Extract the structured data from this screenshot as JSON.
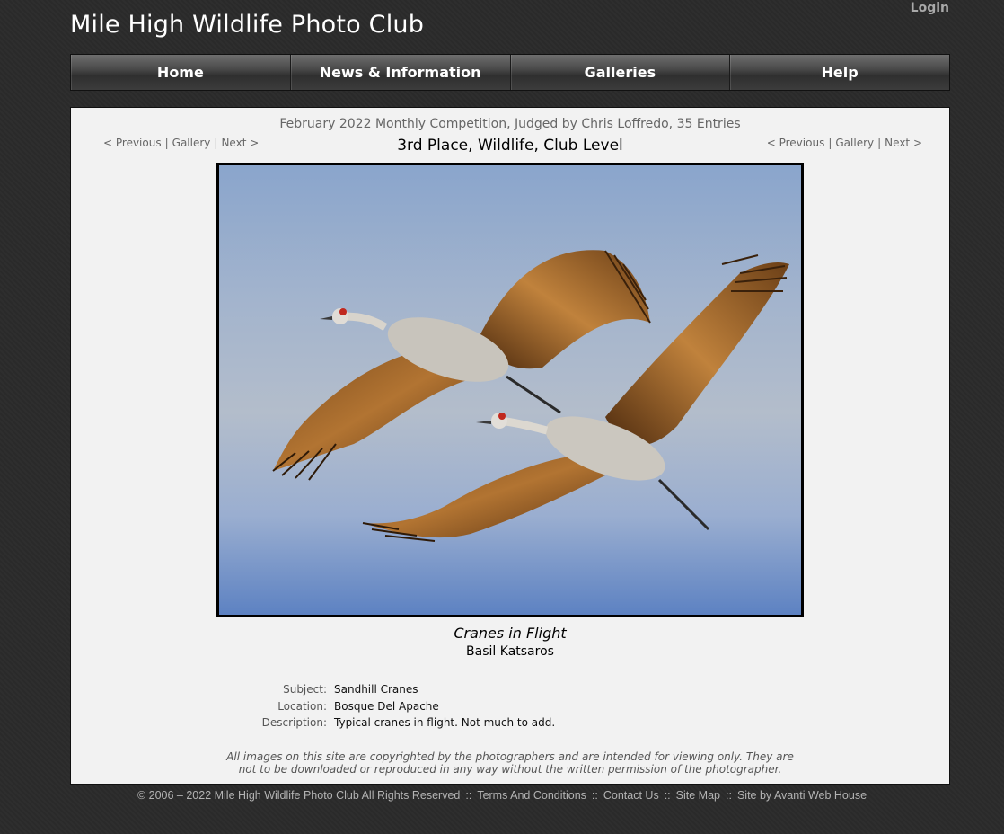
{
  "site": {
    "title": "Mile High Wildlife Photo Club",
    "login_label": "Login"
  },
  "nav": {
    "items": [
      {
        "label": "Home"
      },
      {
        "label": "News & Information"
      },
      {
        "label": "Galleries"
      },
      {
        "label": "Help"
      }
    ]
  },
  "entry": {
    "competition": "February 2022 Monthly Competition, Judged by Chris Loffredo, 35 Entries",
    "placement": "3rd Place, Wildlife, Club Level",
    "pager": {
      "previous": "< Previous",
      "gallery": "Gallery",
      "next": "Next >",
      "separator": "|"
    },
    "photo_title": "Cranes in Flight",
    "photographer": "Basil Katsaros",
    "details": [
      {
        "label": "Subject:",
        "value": "Sandhill Cranes"
      },
      {
        "label": "Location:",
        "value": "Bosque Del Apache"
      },
      {
        "label": "Description:",
        "value": "Typical cranes in flight. Not much to add."
      }
    ],
    "copyright_line1": "All images on this site are copyrighted by the photographers and are intended for viewing only. They are",
    "copyright_line2": "not to be downloaded or reproduced in any way without the written permission of the photographer."
  },
  "footer": {
    "copyright": "© 2006 – 2022 Mile High Wildlife Photo Club All Rights Reserved",
    "separator": "::",
    "terms": "Terms And Conditions",
    "contact": "Contact Us",
    "sitemap": "Site Map",
    "credit": "Site by Avanti Web House"
  },
  "colors": {
    "background": "#2b2b2b",
    "panel": "#f2f2f2",
    "nav_text": "#ffffff",
    "sky": "#9fb2cf",
    "wing": "#b0722e"
  }
}
